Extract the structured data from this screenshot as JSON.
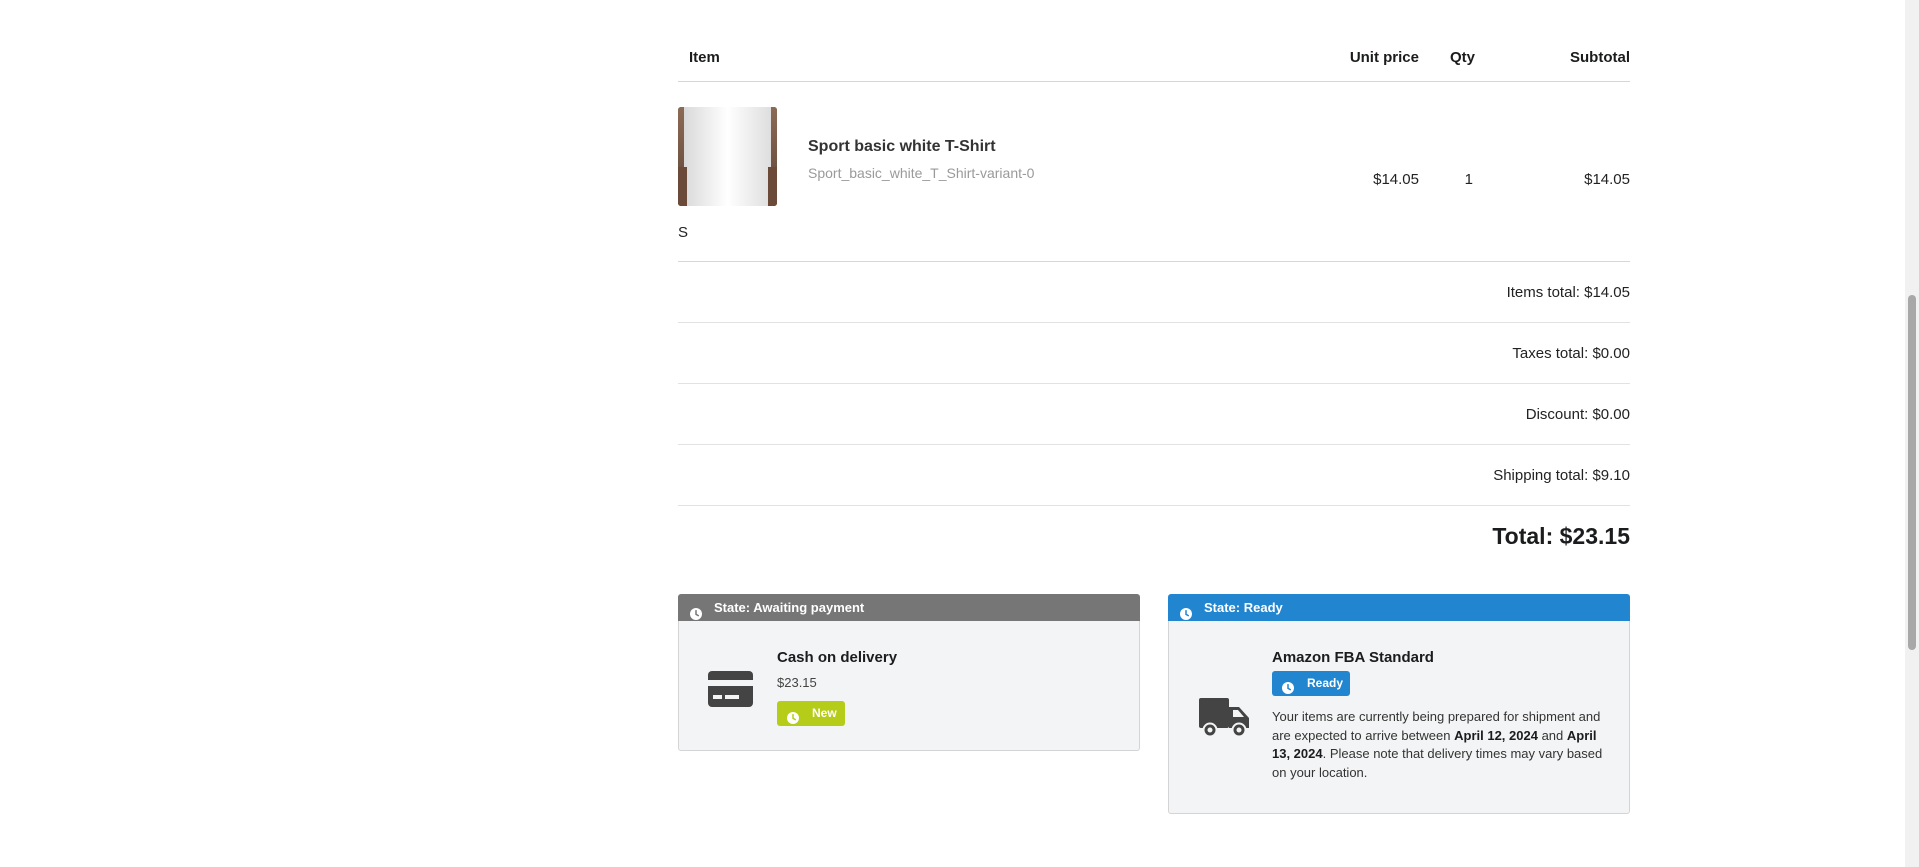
{
  "table": {
    "headers": {
      "item": "Item",
      "unit_price": "Unit price",
      "qty": "Qty",
      "subtotal": "Subtotal"
    },
    "items": [
      {
        "name": "Sport basic white T-Shirt",
        "code": "Sport_basic_white_T_Shirt-variant-0",
        "option": "S",
        "unit_price": "$14.05",
        "qty": "1",
        "subtotal": "$14.05"
      }
    ]
  },
  "summary": {
    "items_total_label": "Items total:",
    "items_total": "$14.05",
    "taxes_total_label": "Taxes total:",
    "taxes_total": "$0.00",
    "discount_label": "Discount:",
    "discount": "$0.00",
    "shipping_total_label": "Shipping total:",
    "shipping_total": "$9.10",
    "total_label": "Total:",
    "total": "$23.15"
  },
  "payment": {
    "state": "State: Awaiting payment",
    "method": "Cash on delivery",
    "amount": "$23.15",
    "status": "New",
    "icon": "credit-card-icon",
    "color": "#767676",
    "status_color": "#b5cc18"
  },
  "shipment": {
    "state": "State: Ready",
    "method": "Amazon FBA Standard",
    "status": "Ready",
    "icon": "truck-icon",
    "color": "#2185d0",
    "desc_1": "Your items are currently being prepared for shipment and are expected to arrive between",
    "date_from": "April 12, 2024",
    "desc_2": "and",
    "date_to": "April 13, 2024",
    "desc_3": ". Please note that delivery times may vary based on your location."
  }
}
